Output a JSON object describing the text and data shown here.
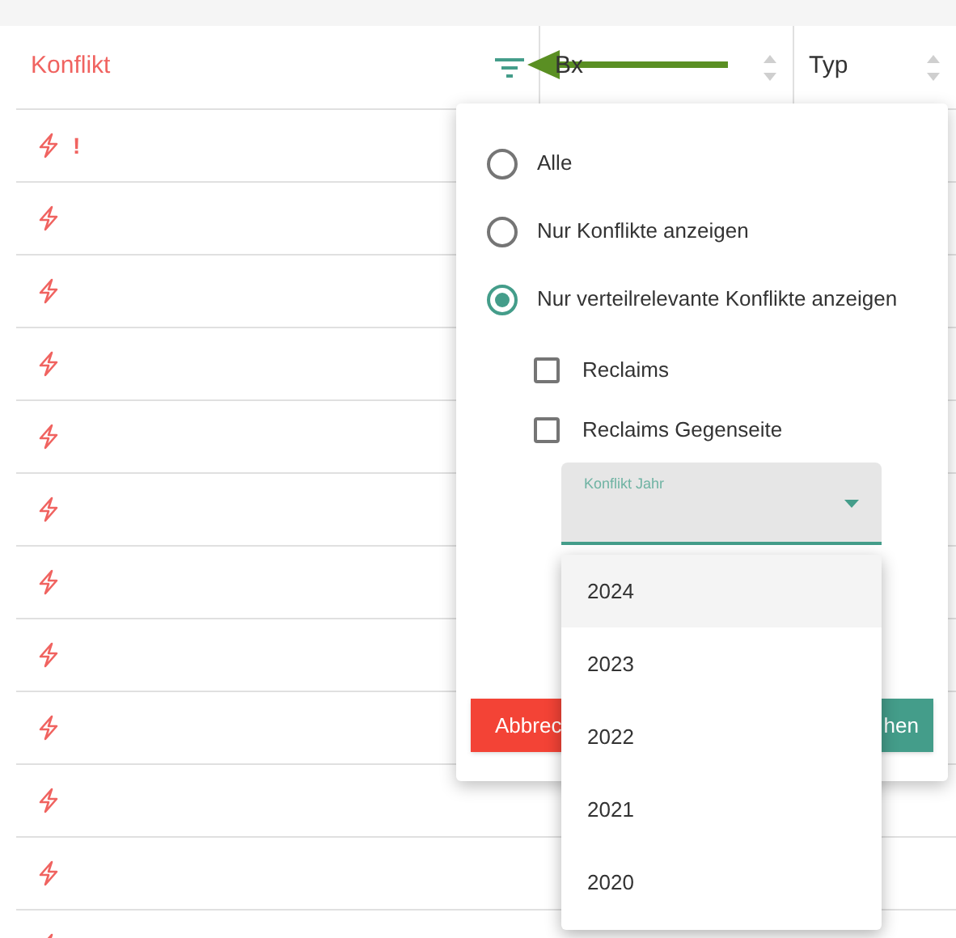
{
  "table": {
    "columns": [
      {
        "label": "Konflikt",
        "kind": "filter"
      },
      {
        "label": "Bx",
        "kind": "sort"
      },
      {
        "label": "Typ",
        "kind": "sort"
      }
    ],
    "rows": [
      {
        "conflict": true,
        "flag": "!"
      },
      {
        "conflict": true
      },
      {
        "conflict": true
      },
      {
        "conflict": true
      },
      {
        "conflict": true
      },
      {
        "conflict": true
      },
      {
        "conflict": true
      },
      {
        "conflict": true
      },
      {
        "conflict": true
      },
      {
        "conflict": true
      },
      {
        "conflict": true
      },
      {
        "conflict": true
      }
    ]
  },
  "filter_popup": {
    "options": [
      {
        "label": "Alle",
        "selected": false
      },
      {
        "label": "Nur Konflikte anzeigen",
        "selected": false
      },
      {
        "label": "Nur verteilrelevante Konflikte anzeigen",
        "selected": true
      }
    ],
    "checkboxes": [
      {
        "label": "Reclaims",
        "checked": false
      },
      {
        "label": "Reclaims Gegenseite",
        "checked": false
      }
    ],
    "select": {
      "label": "Konflikt Jahr",
      "expanded": true,
      "options": [
        {
          "label": "2024",
          "selected": true
        },
        {
          "label": "2023",
          "selected": false
        },
        {
          "label": "2022",
          "selected": false
        },
        {
          "label": "2021",
          "selected": false
        },
        {
          "label": "2020",
          "selected": false
        }
      ]
    },
    "buttons": [
      {
        "label": "Abbrec",
        "kind": "cancel"
      },
      {
        "label": "hen",
        "kind": "apply"
      }
    ]
  }
}
